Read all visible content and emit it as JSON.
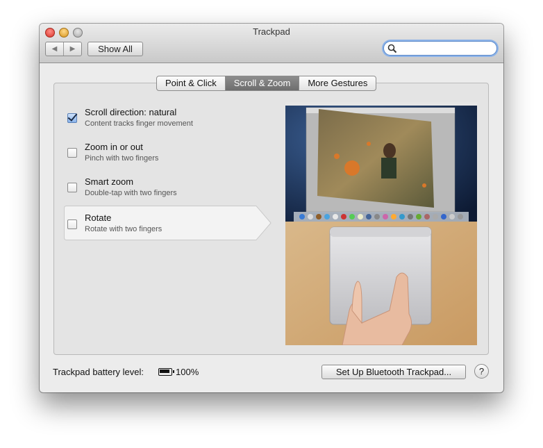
{
  "window": {
    "title": "Trackpad"
  },
  "toolbar": {
    "back_icon": "◀",
    "forward_icon": "▶",
    "show_all_label": "Show All",
    "search_placeholder": ""
  },
  "tabs": [
    {
      "label": "Point & Click",
      "active": false
    },
    {
      "label": "Scroll & Zoom",
      "active": true
    },
    {
      "label": "More Gestures",
      "active": false
    }
  ],
  "options": [
    {
      "title": "Scroll direction: natural",
      "desc": "Content tracks finger movement",
      "checked": true
    },
    {
      "title": "Zoom in or out",
      "desc": "Pinch with two fingers",
      "checked": false
    },
    {
      "title": "Smart zoom",
      "desc": "Double-tap with two fingers",
      "checked": false
    },
    {
      "title": "Rotate",
      "desc": "Rotate with two fingers",
      "checked": false
    }
  ],
  "footer": {
    "battery_label": "Trackpad battery level:",
    "battery_value": "100%",
    "setup_button": "Set Up Bluetooth Trackpad...",
    "help_button": "?"
  },
  "colors": {
    "accent": "#7d7d7d",
    "window_bg": "#ececec",
    "search_ring": "#8db3e8"
  }
}
